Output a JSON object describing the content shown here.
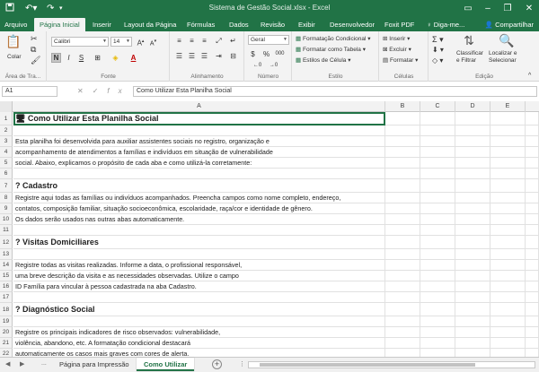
{
  "window": {
    "title": "Sistema de Gestão Social.xlsx - Excel",
    "quick_access": [
      "save-icon",
      "undo-icon",
      "redo-icon",
      "customize-icon"
    ]
  },
  "tabs": [
    {
      "label": "Arquivo"
    },
    {
      "label": "Página Inicial",
      "active": true
    },
    {
      "label": "Inserir"
    },
    {
      "label": "Layout da Página"
    },
    {
      "label": "Fórmulas"
    },
    {
      "label": "Dados"
    },
    {
      "label": "Revisão"
    },
    {
      "label": "Exibir"
    },
    {
      "label": "Desenvolvedor"
    },
    {
      "label": "Foxit PDF"
    },
    {
      "label": "Diga-me..."
    }
  ],
  "share_label": "Compartilhar",
  "ribbon": {
    "clipboard": {
      "paste_label": "Colar",
      "group_label": "Área de Tra..."
    },
    "font": {
      "name": "Calibri",
      "size": "14",
      "group_label": "Fonte",
      "bold": "N",
      "italic": "I",
      "underline": "S"
    },
    "alignment": {
      "group_label": "Alinhamento"
    },
    "number": {
      "format": "Geral",
      "currency": "$",
      "percent": "%",
      "group_label": "Número"
    },
    "styles": {
      "conditional": "Formatação Condicional",
      "as_table": "Formatar como Tabela",
      "cell_styles": "Estilos de Célula",
      "group_label": "Estilo"
    },
    "cells": {
      "insert": "Inserir",
      "delete": "Excluir",
      "format": "Formatar",
      "group_label": "Células"
    },
    "editing": {
      "sort_l1": "Classificar",
      "sort_l2": "e Filtrar",
      "find_l1": "Localizar e",
      "find_l2": "Selecionar",
      "group_label": "Edição"
    }
  },
  "formula_bar": {
    "name_box": "A1",
    "content": "Como Utilizar Esta Planilha Social"
  },
  "columns": [
    "A",
    "B",
    "C",
    "D",
    "E"
  ],
  "rows": [
    {
      "n": "1",
      "text": "🖥 Como Utilizar Esta Planilha Social",
      "heading": true
    },
    {
      "n": "2",
      "text": ""
    },
    {
      "n": "3",
      "text": "Esta planilha foi desenvolvida para auxiliar assistentes sociais no registro, organização e"
    },
    {
      "n": "4",
      "text": "acompanhamento de atendimentos a famílias e indivíduos em situação de vulnerabilidade"
    },
    {
      "n": "5",
      "text": "social. Abaixo, explicamos o propósito de cada aba e como utilizá-la corretamente:"
    },
    {
      "n": "6",
      "text": ""
    },
    {
      "n": "7",
      "text": "? Cadastro",
      "heading": true
    },
    {
      "n": "8",
      "text": "Registre aqui todas as famílias ou indivíduos acompanhados. Preencha campos como nome completo, endereço,"
    },
    {
      "n": "9",
      "text": "contatos, composição familiar, situação socioeconômica, escolaridade, raça/cor e identidade de gênero."
    },
    {
      "n": "10",
      "text": "Os dados serão usados nas outras abas automaticamente."
    },
    {
      "n": "11",
      "text": ""
    },
    {
      "n": "12",
      "text": "? Visitas Domiciliares",
      "heading": true
    },
    {
      "n": "13",
      "text": ""
    },
    {
      "n": "14",
      "text": "Registre todas as visitas realizadas. Informe a data, o profissional responsável,"
    },
    {
      "n": "15",
      "text": "uma breve descrição da visita e as necessidades observadas. Utilize o campo"
    },
    {
      "n": "16",
      "text": "ID Família para vincular à pessoa cadastrada na aba Cadastro."
    },
    {
      "n": "17",
      "text": ""
    },
    {
      "n": "18",
      "text": "? Diagnóstico Social",
      "heading": true
    },
    {
      "n": "19",
      "text": ""
    },
    {
      "n": "20",
      "text": "Registre os principais indicadores de risco observados: vulnerabilidade,"
    },
    {
      "n": "21",
      "text": "violência, abandono, etc. A formatação condicional destacará"
    },
    {
      "n": "22",
      "text": "automaticamente os casos mais graves com cores de alerta."
    }
  ],
  "sheet_tabs": {
    "nav_prev": "◀",
    "nav_next": "▶",
    "nav_more": "...",
    "tabs": [
      {
        "label": "Página para Impressão"
      },
      {
        "label": "Como Utilizar",
        "active": true
      }
    ],
    "add": "+"
  },
  "colors": {
    "excel_green": "#217346",
    "ribbon_bg": "#f3f3f3"
  }
}
